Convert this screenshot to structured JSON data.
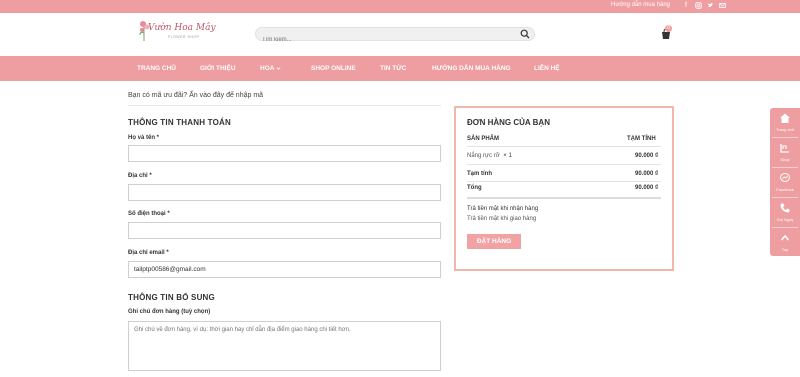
{
  "topbar": {
    "guide_link": "Hướng dẫn mua hàng",
    "social": [
      "facebook-icon",
      "instagram-icon",
      "twitter-icon",
      "email-icon"
    ]
  },
  "header": {
    "logo_text": "Vườn Hoa Mây",
    "logo_sub": "FLOWER SHOP",
    "search_placeholder": "Tìm kiếm...",
    "cart_count": "0"
  },
  "nav": {
    "items": [
      "TRANG CHỦ",
      "GIỚI THIỆU",
      "HOA",
      "SHOP ONLINE",
      "TIN TỨC",
      "HƯỚNG DẪN MUA HÀNG",
      "LIÊN HỆ"
    ]
  },
  "coupon": {
    "text": "Bạn có mã ưu đãi? Ấn vào đây để nhập mã"
  },
  "billing": {
    "title": "THÔNG TIN THANH TOÁN",
    "name_label": "Họ và tên *",
    "address_label": "Địa chỉ *",
    "phone_label": "Số điện thoại *",
    "email_label": "Địa chỉ email *",
    "email_value": "tailptp00586@gmail.com"
  },
  "extra": {
    "title": "THÔNG TIN BỔ SUNG",
    "notes_label": "Ghi chú đơn hàng (tuỳ chọn)",
    "notes_placeholder": "Ghi chú về đơn hàng, ví dụ: thời gian hay chỉ dẫn địa điểm giao hàng chi tiết hơn."
  },
  "order": {
    "title": "ĐƠN HÀNG CỦA BẠN",
    "col_product": "SẢN PHẨM",
    "col_subtotal": "TẠM TÍNH",
    "item_name": "Nắng rực rỡ",
    "item_qty": "× 1",
    "item_price": "90.000 ₫",
    "subtotal_label": "Tạm tính",
    "subtotal_value": "90.000 ₫",
    "total_label": "Tổng",
    "total_value": "90.000 ₫",
    "payment_method": "Trả tiền mặt khi nhận hàng",
    "payment_desc": "Trả tiền mặt khi giao hàng",
    "button": "ĐẶT HÀNG"
  },
  "float_bar": {
    "items": [
      {
        "icon": "home-icon",
        "label": "Trang chủ"
      },
      {
        "icon": "shop-icon",
        "label": "Shop"
      },
      {
        "icon": "messenger-icon",
        "label": "Facebook"
      },
      {
        "icon": "phone-icon",
        "label": "Gọi Ngay"
      },
      {
        "icon": "arrow-up-icon",
        "label": "Top"
      }
    ]
  },
  "colors": {
    "brand_pink": "#ee9ea0",
    "order_border": "#f1b7a8",
    "button_pink": "#f1a3a3"
  }
}
